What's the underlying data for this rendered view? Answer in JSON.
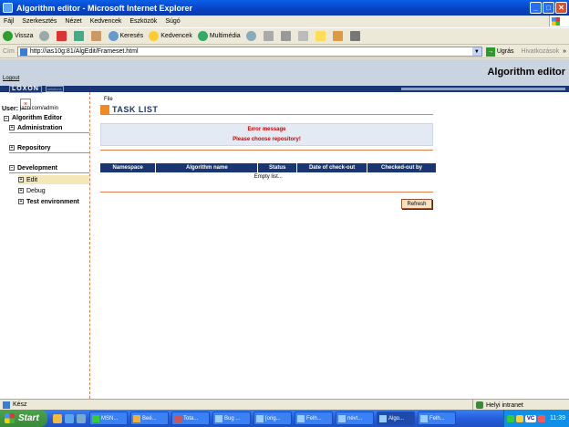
{
  "window": {
    "title": "Algorithm editor - Microsoft Internet Explorer",
    "min_glyph": "_",
    "max_glyph": "□",
    "close_glyph": "✕"
  },
  "menu": [
    "Fájl",
    "Szerkesztés",
    "Nézet",
    "Kedvencek",
    "Eszközök",
    "Súgó"
  ],
  "toolbar": {
    "back": "Vissza",
    "search": "Keresés",
    "favorites": "Kedvencek",
    "media": "Multimédia"
  },
  "address": {
    "label": "Cím",
    "url": "http://ias10g:81/AlgEdit/Frameset.html",
    "go": "Ugrás",
    "links": "Hivatkozások"
  },
  "app": {
    "logout": "Logout",
    "title": "Algorithm editor",
    "logo": "LOXON",
    "logo_sub": "solutions"
  },
  "sidebar": {
    "user_label": "User:",
    "user_value": "jazn.com/admin",
    "root": "Algorithm Editor",
    "items": [
      {
        "label": "Administration"
      },
      {
        "label": "Repository"
      },
      {
        "label": "Development"
      }
    ],
    "subitems": [
      {
        "label": "Edit"
      },
      {
        "label": "Debug"
      },
      {
        "label": "Test environment"
      }
    ]
  },
  "main": {
    "file_label": "File",
    "title": "TASK LIST",
    "error_title": "Error message",
    "error_text": "Please choose repository!",
    "columns": [
      "Namespace",
      "Algorithm name",
      "Status",
      "Date of check-out",
      "Checked-out by"
    ],
    "empty_text": "Empty list...",
    "refresh": "Refresh"
  },
  "status": {
    "text": "Kész",
    "zone": "Helyi intranet"
  },
  "taskbar": {
    "start": "Start",
    "tasks": [
      "MSN...",
      "Beé...",
      "Tota...",
      "Bug ...",
      "[orig...",
      "Felh...",
      "névt...",
      "Algo...",
      "Felh..."
    ],
    "clock": "11:39",
    "tray_lang": "VC"
  }
}
